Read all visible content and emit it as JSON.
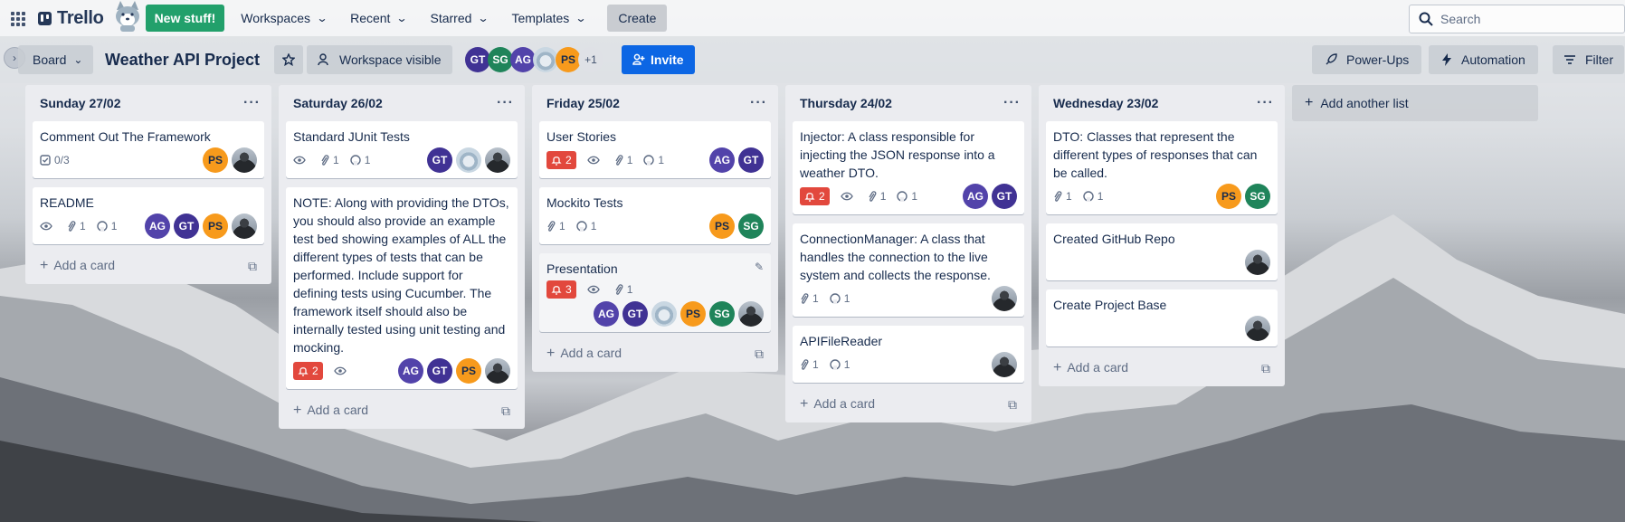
{
  "app": {
    "logo_text": "Trello",
    "new_stuff": "New stuff!",
    "create": "Create",
    "search_placeholder": "Search"
  },
  "nav": [
    {
      "label": "Workspaces"
    },
    {
      "label": "Recent"
    },
    {
      "label": "Starred"
    },
    {
      "label": "Templates"
    }
  ],
  "board": {
    "view": "Board",
    "title": "Weather API Project",
    "visibility": "Workspace visible",
    "invite": "Invite",
    "more_members": "+1",
    "powerups": "Power-Ups",
    "automation": "Automation",
    "filter": "Filter",
    "add_list": "Add another list"
  },
  "lists": [
    {
      "title": "Sunday 27/02",
      "add": "Add a card",
      "cards": [
        {
          "title": "Comment Out The Framework",
          "checklist": "0/3",
          "members": [
            "PS",
            "photo"
          ]
        },
        {
          "title": "README",
          "attachments": "1",
          "github": "1",
          "watch": true,
          "members": [
            "AG",
            "GT",
            "PS",
            "photo"
          ]
        }
      ]
    },
    {
      "title": "Saturday 26/02",
      "add": "Add a card",
      "cards": [
        {
          "title": "Standard JUnit Tests",
          "watch": true,
          "attachments": "1",
          "github": "1",
          "members": [
            "GT",
            "cloud",
            "photo"
          ]
        },
        {
          "title": "NOTE: Along with providing the DTOs, you should also provide an example test bed showing examples of ALL the different types of tests that can be performed. Include support for defining tests using Cucumber. The framework itself should also be internally tested using unit testing and mocking.",
          "due": "2",
          "watch": true,
          "members": [
            "AG",
            "GT",
            "PS",
            "photo"
          ]
        }
      ]
    },
    {
      "title": "Friday 25/02",
      "add": "Add a card",
      "cards": [
        {
          "title": "User Stories",
          "due": "2",
          "watch": true,
          "attachments": "1",
          "github": "1",
          "members": [
            "AG",
            "GT"
          ]
        },
        {
          "title": "Mockito Tests",
          "attachments": "1",
          "github": "1",
          "members": [
            "PS",
            "SG"
          ]
        },
        {
          "title": "Presentation",
          "due": "3",
          "watch": true,
          "attachments": "1",
          "members": [
            "AG",
            "GT",
            "cloud",
            "PS",
            "SG",
            "photo"
          ]
        }
      ]
    },
    {
      "title": "Thursday 24/02",
      "add": "Add a card",
      "cards": [
        {
          "title": "Injector: A class responsible for injecting the JSON response into a weather DTO.",
          "due": "2",
          "watch": true,
          "attachments": "1",
          "github": "1",
          "members": [
            "AG",
            "GT"
          ]
        },
        {
          "title": "ConnectionManager: A class that handles the connection to the live system and collects the response.",
          "attachments": "1",
          "github": "1",
          "members": [
            "photo"
          ]
        },
        {
          "title": "APIFileReader",
          "attachments": "1",
          "github": "1",
          "members": [
            "photo"
          ]
        }
      ]
    },
    {
      "title": "Wednesday 23/02",
      "add": "Add a card",
      "cards": [
        {
          "title": "DTO: Classes that represent the different types of responses that can be called.",
          "attachments": "1",
          "github": "1",
          "members": [
            "PS",
            "SG"
          ]
        },
        {
          "title": "Created GitHub Repo",
          "members": [
            "photo"
          ]
        },
        {
          "title": "Create Project Base",
          "members": [
            "photo"
          ]
        }
      ]
    }
  ],
  "header_members": [
    "GT",
    "SG",
    "AG",
    "cloud",
    "PS"
  ],
  "colors": {
    "invite": "#0c66e4",
    "new_stuff": "#22a06b",
    "due": "#e2483d"
  }
}
